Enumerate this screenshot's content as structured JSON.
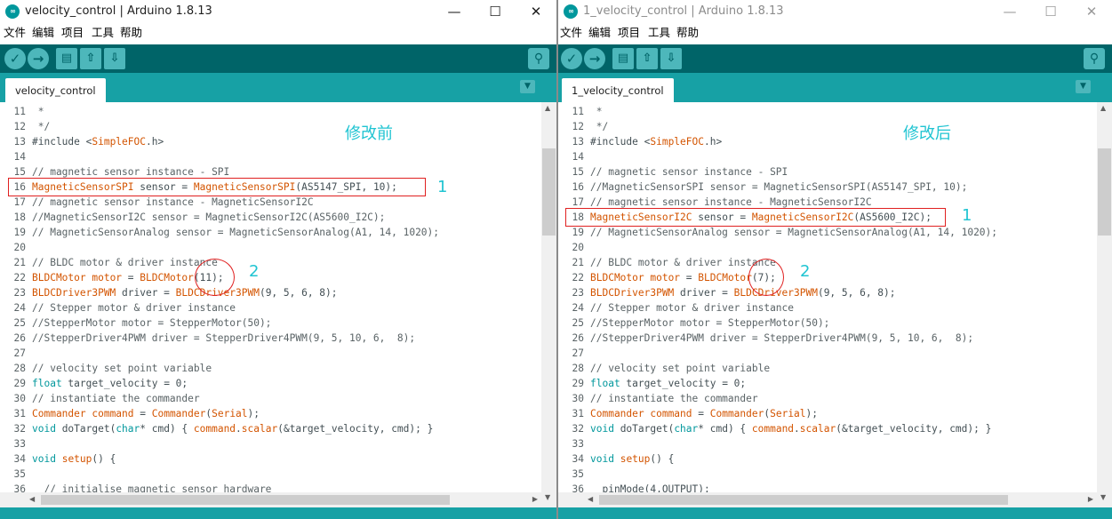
{
  "left": {
    "title": "velocity_control | Arduino 1.8.13",
    "tab": "velocity_control",
    "annotation": "修改前",
    "lines": [
      [
        {
          "n": "11"
        },
        {
          "t": " *",
          "c": "cm"
        }
      ],
      [
        {
          "n": "12"
        },
        {
          "t": " */",
          "c": "cm"
        }
      ],
      [
        {
          "n": "13"
        },
        {
          "t": "#include <",
          "c": ""
        },
        {
          "t": "SimpleFOC",
          "c": "kw"
        },
        {
          "t": ".h>",
          "c": ""
        }
      ],
      [
        {
          "n": "14"
        }
      ],
      [
        {
          "n": "15"
        },
        {
          "t": "// magnetic sensor instance - SPI",
          "c": "cm"
        }
      ],
      [
        {
          "n": "16"
        },
        {
          "t": "MagneticSensorSPI",
          "c": "hl"
        },
        {
          "t": " sensor = ",
          "c": ""
        },
        {
          "t": "MagneticSensorSPI",
          "c": "hl"
        },
        {
          "t": "(AS5147_SPI, 10);",
          "c": ""
        }
      ],
      [
        {
          "n": "17"
        },
        {
          "t": "// magnetic sensor instance - MagneticSensorI2C",
          "c": "cm"
        }
      ],
      [
        {
          "n": "18"
        },
        {
          "t": "//MagneticSensorI2C sensor = MagneticSensorI2C(AS5600_I2C);",
          "c": "cm"
        }
      ],
      [
        {
          "n": "19"
        },
        {
          "t": "// MagneticSensorAnalog sensor = MagneticSensorAnalog(A1, 14, 1020);",
          "c": "cm"
        }
      ],
      [
        {
          "n": "20"
        }
      ],
      [
        {
          "n": "21"
        },
        {
          "t": "// BLDC motor & driver instance",
          "c": "cm"
        }
      ],
      [
        {
          "n": "22"
        },
        {
          "t": "BLDCMotor",
          "c": "kw"
        },
        {
          "t": " motor",
          "c": "kw"
        },
        {
          "t": " = ",
          "c": ""
        },
        {
          "t": "BLDCMotor",
          "c": "kw"
        },
        {
          "t": "(11);",
          "c": ""
        }
      ],
      [
        {
          "n": "23"
        },
        {
          "t": "BLDCDriver3PWM",
          "c": "kw"
        },
        {
          "t": " driver = ",
          "c": ""
        },
        {
          "t": "BLDCDriver3PWM",
          "c": "kw"
        },
        {
          "t": "(9, 5, 6, 8);",
          "c": ""
        }
      ],
      [
        {
          "n": "24"
        },
        {
          "t": "// Stepper motor & driver instance",
          "c": "cm"
        }
      ],
      [
        {
          "n": "25"
        },
        {
          "t": "//StepperMotor motor = StepperMotor(50);",
          "c": "cm"
        }
      ],
      [
        {
          "n": "26"
        },
        {
          "t": "//StepperDriver4PWM driver = StepperDriver4PWM(9, 5, 10, 6,  8);",
          "c": "cm"
        }
      ],
      [
        {
          "n": "27"
        }
      ],
      [
        {
          "n": "28"
        },
        {
          "t": "// velocity set point variable",
          "c": "cm"
        }
      ],
      [
        {
          "n": "29"
        },
        {
          "t": "float",
          "c": "ty"
        },
        {
          "t": " target_velocity = 0;",
          "c": ""
        }
      ],
      [
        {
          "n": "30"
        },
        {
          "t": "// instantiate the commander",
          "c": "cm"
        }
      ],
      [
        {
          "n": "31"
        },
        {
          "t": "Commander",
          "c": "kw"
        },
        {
          "t": " command",
          "c": "kw"
        },
        {
          "t": " = ",
          "c": ""
        },
        {
          "t": "Commander",
          "c": "kw"
        },
        {
          "t": "(",
          "c": ""
        },
        {
          "t": "Serial",
          "c": "kw"
        },
        {
          "t": ");",
          "c": ""
        }
      ],
      [
        {
          "n": "32"
        },
        {
          "t": "void",
          "c": "ty"
        },
        {
          "t": " doTarget(",
          "c": ""
        },
        {
          "t": "char",
          "c": "ty"
        },
        {
          "t": "* cmd) { ",
          "c": ""
        },
        {
          "t": "command",
          "c": "kw"
        },
        {
          "t": ".",
          "c": ""
        },
        {
          "t": "scalar",
          "c": "kw"
        },
        {
          "t": "(&target_velocity, cmd); }",
          "c": ""
        }
      ],
      [
        {
          "n": "33"
        }
      ],
      [
        {
          "n": "34"
        },
        {
          "t": "void",
          "c": "ty"
        },
        {
          "t": " ",
          "c": ""
        },
        {
          "t": "setup",
          "c": "kw"
        },
        {
          "t": "() {",
          "c": ""
        }
      ],
      [
        {
          "n": "35"
        }
      ],
      [
        {
          "n": "36"
        },
        {
          "t": "  // initialise magnetic sensor hardware",
          "c": "cm"
        }
      ]
    ]
  },
  "right": {
    "title": "1_velocity_control | Arduino 1.8.13",
    "tab": "1_velocity_control",
    "annotation": "修改后",
    "lines": [
      [
        {
          "n": "11"
        },
        {
          "t": " *",
          "c": "cm"
        }
      ],
      [
        {
          "n": "12"
        },
        {
          "t": " */",
          "c": "cm"
        }
      ],
      [
        {
          "n": "13"
        },
        {
          "t": "#include <",
          "c": ""
        },
        {
          "t": "SimpleFOC",
          "c": "kw"
        },
        {
          "t": ".h>",
          "c": ""
        }
      ],
      [
        {
          "n": "14"
        }
      ],
      [
        {
          "n": "15"
        },
        {
          "t": "// magnetic sensor instance - SPI",
          "c": "cm"
        }
      ],
      [
        {
          "n": "16"
        },
        {
          "t": "//MagneticSensorSPI sensor = MagneticSensorSPI(AS5147_SPI, 10);",
          "c": "cm"
        }
      ],
      [
        {
          "n": "17"
        },
        {
          "t": "// magnetic sensor instance - MagneticSensorI2C",
          "c": "cm"
        }
      ],
      [
        {
          "n": "18"
        },
        {
          "t": "MagneticSensorI2C",
          "c": "hl"
        },
        {
          "t": " sensor = ",
          "c": ""
        },
        {
          "t": "MagneticSensorI2C",
          "c": "hl"
        },
        {
          "t": "(AS5600_I2C);",
          "c": ""
        }
      ],
      [
        {
          "n": "19"
        },
        {
          "t": "// MagneticSensorAnalog sensor = MagneticSensorAnalog(A1, 14, 1020);",
          "c": "cm"
        }
      ],
      [
        {
          "n": "20"
        }
      ],
      [
        {
          "n": "21"
        },
        {
          "t": "// BLDC motor & driver instance",
          "c": "cm"
        }
      ],
      [
        {
          "n": "22"
        },
        {
          "t": "BLDCMotor",
          "c": "kw"
        },
        {
          "t": " motor",
          "c": "kw"
        },
        {
          "t": " = ",
          "c": ""
        },
        {
          "t": "BLDCMotor",
          "c": "kw"
        },
        {
          "t": "(7);",
          "c": ""
        }
      ],
      [
        {
          "n": "23"
        },
        {
          "t": "BLDCDriver3PWM",
          "c": "kw"
        },
        {
          "t": " driver = ",
          "c": ""
        },
        {
          "t": "BLDCDriver3PWM",
          "c": "kw"
        },
        {
          "t": "(9, 5, 6, 8);",
          "c": ""
        }
      ],
      [
        {
          "n": "24"
        },
        {
          "t": "// Stepper motor & driver instance",
          "c": "cm"
        }
      ],
      [
        {
          "n": "25"
        },
        {
          "t": "//StepperMotor motor = StepperMotor(50);",
          "c": "cm"
        }
      ],
      [
        {
          "n": "26"
        },
        {
          "t": "//StepperDriver4PWM driver = StepperDriver4PWM(9, 5, 10, 6,  8);",
          "c": "cm"
        }
      ],
      [
        {
          "n": "27"
        }
      ],
      [
        {
          "n": "28"
        },
        {
          "t": "// velocity set point variable",
          "c": "cm"
        }
      ],
      [
        {
          "n": "29"
        },
        {
          "t": "float",
          "c": "ty"
        },
        {
          "t": " target_velocity = 0;",
          "c": ""
        }
      ],
      [
        {
          "n": "30"
        },
        {
          "t": "// instantiate the commander",
          "c": "cm"
        }
      ],
      [
        {
          "n": "31"
        },
        {
          "t": "Commander",
          "c": "kw"
        },
        {
          "t": " command",
          "c": "kw"
        },
        {
          "t": " = ",
          "c": ""
        },
        {
          "t": "Commander",
          "c": "kw"
        },
        {
          "t": "(",
          "c": ""
        },
        {
          "t": "Serial",
          "c": "kw"
        },
        {
          "t": ");",
          "c": ""
        }
      ],
      [
        {
          "n": "32"
        },
        {
          "t": "void",
          "c": "ty"
        },
        {
          "t": " doTarget(",
          "c": ""
        },
        {
          "t": "char",
          "c": "ty"
        },
        {
          "t": "* cmd) { ",
          "c": ""
        },
        {
          "t": "command",
          "c": "kw"
        },
        {
          "t": ".",
          "c": ""
        },
        {
          "t": "scalar",
          "c": "kw"
        },
        {
          "t": "(&target_velocity, cmd); }",
          "c": ""
        }
      ],
      [
        {
          "n": "33"
        }
      ],
      [
        {
          "n": "34"
        },
        {
          "t": "void",
          "c": "ty"
        },
        {
          "t": " ",
          "c": ""
        },
        {
          "t": "setup",
          "c": "kw"
        },
        {
          "t": "() {",
          "c": ""
        }
      ],
      [
        {
          "n": "35"
        }
      ],
      [
        {
          "n": "36"
        },
        {
          "t": "  pinMode(4,OUTPUT);",
          "c": ""
        }
      ]
    ]
  },
  "menu": [
    "文件",
    "编辑",
    "项目",
    "工具",
    "帮助"
  ],
  "marker_1": "1",
  "marker_2": "2",
  "colors": {
    "toolbar": "#006468",
    "tabbar": "#17a1a5",
    "keyword": "#d35400",
    "type": "#00979c",
    "annotation": "#20c4d2",
    "highlight_box": "#e02020"
  },
  "icons": [
    "verify-icon",
    "upload-icon",
    "new-icon",
    "open-icon",
    "save-icon",
    "serial-monitor-icon",
    "tab-menu-icon",
    "arduino-logo-icon"
  ]
}
